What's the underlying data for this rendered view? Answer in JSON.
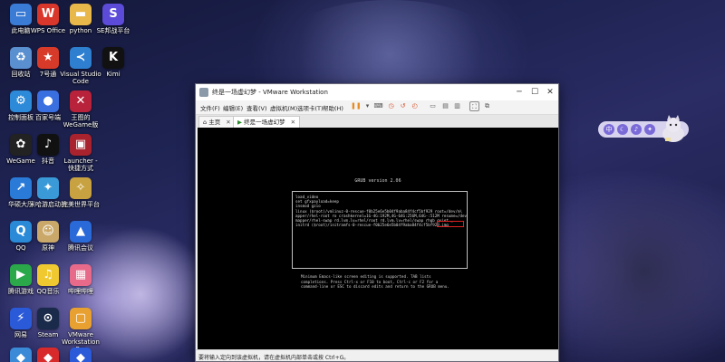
{
  "desktop_icons": [
    {
      "label": "此电脑",
      "icon": "computer-icon",
      "color": "#3a7bd5"
    },
    {
      "label": "WPS Office",
      "icon": "wps-icon",
      "color": "#d9372b"
    },
    {
      "label": "python",
      "icon": "folder-icon",
      "color": "#e8b84a"
    },
    {
      "label": "SE邦战平台",
      "icon": "se-icon",
      "color": "#5b4bd8"
    },
    {
      "label": "回收站",
      "icon": "recycle-bin-icon",
      "color": "#5a8fd0"
    },
    {
      "label": "7号通",
      "icon": "red-app-icon",
      "color": "#d83a2a"
    },
    {
      "label": "Visual Studio Code",
      "icon": "vscode-icon",
      "color": "#2e7fd0"
    },
    {
      "label": "Kimi",
      "icon": "kimi-icon",
      "color": "#111111"
    },
    {
      "label": "控制面板",
      "icon": "control-panel-icon",
      "color": "#2c8ad8"
    },
    {
      "label": "百家号端",
      "icon": "baijia-icon",
      "color": "#3a6fe0"
    },
    {
      "label": "王图的WeGame版",
      "icon": "wegame-game-icon",
      "color": "#b8223a"
    },
    {
      "label": "WeGame",
      "icon": "wegame-icon",
      "color": "#222222"
    },
    {
      "label": "抖音",
      "icon": "douyin-icon",
      "color": "#111111"
    },
    {
      "label": "Launcher - 快捷方式",
      "icon": "launcher-icon",
      "color": "#a8232d"
    },
    {
      "label": "华硕大厅",
      "icon": "asus-icon",
      "color": "#2a7ad8"
    },
    {
      "label": "米哈游启动器",
      "icon": "mihoyo-icon",
      "color": "#3a9ad8"
    },
    {
      "label": "完美世界平台",
      "icon": "perfect-world-icon",
      "color": "#c8a240"
    },
    {
      "label": "QQ",
      "icon": "qq-icon",
      "color": "#2a8ad8"
    },
    {
      "label": "原神",
      "icon": "genshin-icon",
      "color": "#caa86a"
    },
    {
      "label": "腾讯会议",
      "icon": "tencent-meeting-icon",
      "color": "#2a6ad8"
    },
    {
      "label": "腾讯游戏",
      "icon": "tencent-games-icon",
      "color": "#2aa84a"
    },
    {
      "label": "QQ音乐",
      "icon": "qq-music-icon",
      "color": "#f0c830"
    },
    {
      "label": "哔哩哔哩",
      "icon": "bilibili-icon",
      "color": "#e86a8a"
    },
    {
      "label": "网易",
      "icon": "netease-icon",
      "color": "#2a5ad8"
    },
    {
      "label": "Steam",
      "icon": "steam-icon",
      "color": "#1a2a4a"
    },
    {
      "label": "VMware Workstation Pro",
      "icon": "vmware-icon",
      "color": "#e8a030"
    },
    {
      "label": "",
      "icon": "app-icon",
      "color": "#3a8ad8"
    },
    {
      "label": "",
      "icon": "app-icon",
      "color": "#d82a2a"
    },
    {
      "label": "",
      "icon": "app-icon",
      "color": "#2a5ad8"
    }
  ],
  "window": {
    "title": "终是一场虚幻梦 - VMware Workstation",
    "menu": [
      "文件(F)",
      "编辑(E)",
      "查看(V)",
      "虚拟机(M)",
      "选项卡(T)",
      "帮助(H)"
    ],
    "tabs": [
      {
        "label": "主页",
        "icon": "home-icon"
      },
      {
        "label": "终是一场虚幻梦",
        "icon": "vm-tab-icon"
      }
    ],
    "status": "要将输入定向到该虚拟机，请在虚拟机内部单击或按 Ctrl+G。"
  },
  "grub": {
    "header": "GRUB version 2.06",
    "lines": [
      "load_video",
      "set gfxpayload=keep",
      "insmod gzio",
      "linux ($root)/vmlinuz-0-rescue-f0b25e6e5b04f9aba84f4cf5bf929 root=/dev/m\\",
      "apper/rhel-root ro crashkernel=1G-4G:192M,4G-64G:256M,64G-:512M resume=/dev/\\",
      "mapper/rhel-swap rd.lvm.lv=rhel/root rd.lvm.lv=rhel/swap rhgb quiet _",
      "initrd ($root)/initramfs-0-rescue-f0b25e6e5b04f9aba84f4cf5bf929.img"
    ],
    "help": [
      "Minimum Emacs-like screen editing is supported. TAB lists",
      "completions. Press Ctrl-x or F10 to boot, Ctrl-c or F2 for a",
      "command-line or ESC to discard edits and return to the GRUB menu."
    ]
  }
}
